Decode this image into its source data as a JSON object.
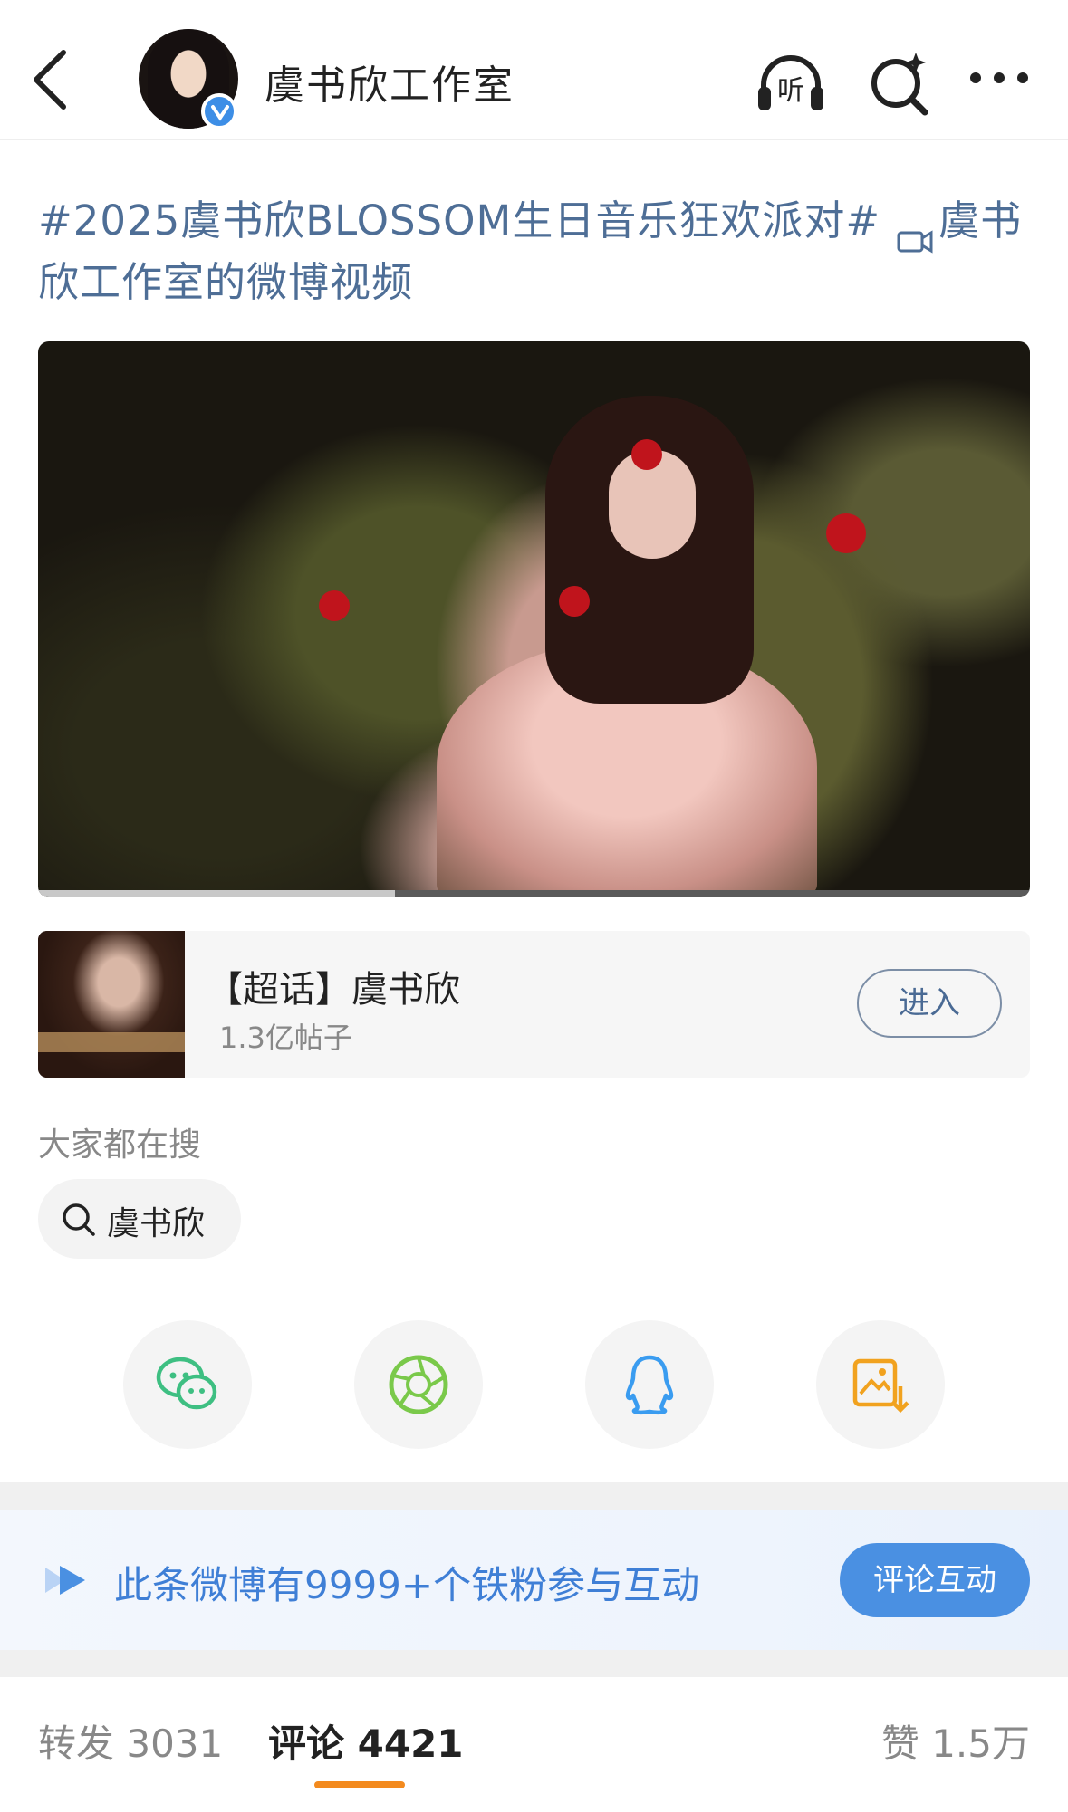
{
  "header": {
    "account_name": "虞书欣工作室",
    "listen_label": "听",
    "icons": [
      "back-arrow-icon",
      "listen-headphone-icon",
      "ai-search-icon",
      "more-icon"
    ]
  },
  "post": {
    "title_text": "#2025虞书欣BLOSSOM生日音乐狂欢派对#",
    "video_link_text": "虞书欣工作室的微博视频",
    "video_progress": 0.36
  },
  "super_topic": {
    "title": "【超话】虞书欣",
    "post_count": "1.3亿帖子",
    "enter_label": "进入"
  },
  "search": {
    "label": "大家都在搜",
    "chip": "虞书欣"
  },
  "share": {
    "items": [
      "wechat-icon",
      "moments-icon",
      "qq-icon",
      "save-image-icon"
    ]
  },
  "fan_banner": {
    "text": "此条微博有9999+个铁粉参与互动",
    "button": "评论互动"
  },
  "tabs": {
    "repost": "转发 3031",
    "comment": "评论 4421",
    "like": "赞 1.5万"
  },
  "colors": {
    "link_blue": "#4e6e96",
    "accent_blue": "#4a90e2",
    "indicator_orange": "#f38a1e"
  }
}
